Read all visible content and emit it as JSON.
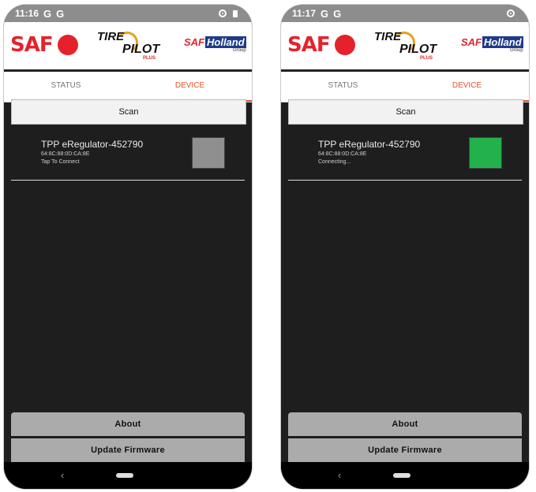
{
  "screens": [
    {
      "time": "11:16",
      "g1": "G",
      "g2": "G",
      "logo_saf": "SAF",
      "logo_tirepilot": {
        "tire": "TIRE",
        "pilot": "PILOT",
        "plus": "PLUS"
      },
      "logo_safholland": {
        "main": "SAF",
        "holland": "Holland",
        "group": "Group"
      },
      "tabs": [
        {
          "label": "STATUS"
        },
        {
          "label": "DEVICE"
        }
      ],
      "scan_label": "Scan",
      "device": {
        "name": "TPP eRegulator-452790",
        "mac": "64:8C:88:0D:CA:8E",
        "status": "Tap To Connect",
        "indicator_color": "#8f8f8f"
      },
      "about_label": "About",
      "update_label": "Update Firmware",
      "back_glyph": "‹"
    },
    {
      "time": "11:17",
      "g1": "G",
      "g2": "G",
      "logo_saf": "SAF",
      "logo_tirepilot": {
        "tire": "TIRE",
        "pilot": "PILOT",
        "plus": "PLUS"
      },
      "logo_safholland": {
        "main": "SAF",
        "holland": "Holland",
        "group": "Group"
      },
      "tabs": [
        {
          "label": "STATUS"
        },
        {
          "label": "DEVICE"
        }
      ],
      "scan_label": "Scan",
      "device": {
        "name": "TPP eRegulator-452790",
        "mac": "64:8C:88:0D:CA:8E",
        "status": "Connecting...",
        "indicator_color": "#22b14c"
      },
      "about_label": "About",
      "update_label": "Update Firmware",
      "back_glyph": "‹"
    }
  ],
  "colors": {
    "accent": "#e5552c",
    "brand_red": "#e5222c",
    "background": "#1e1e1e"
  }
}
